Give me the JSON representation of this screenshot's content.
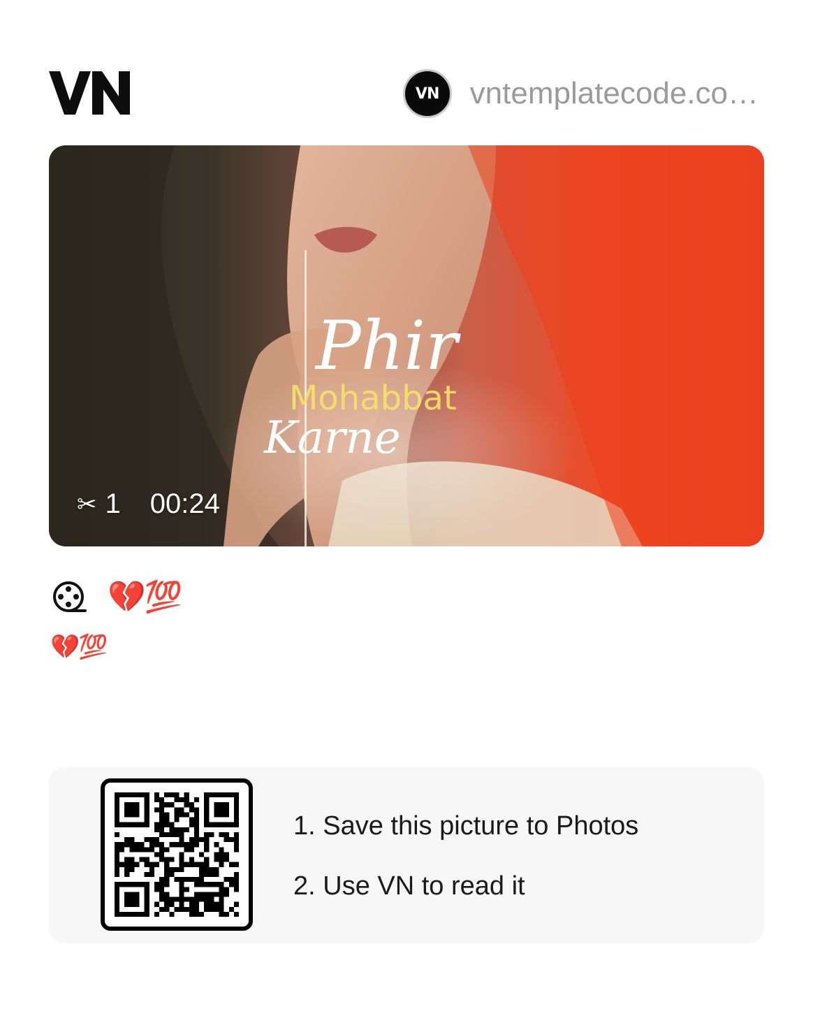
{
  "header": {
    "logo_text": "VN",
    "author_avatar_text": "VN",
    "author_name": "vntemplatecode.co…"
  },
  "preview": {
    "overlay_text": {
      "line1": "Phir",
      "line2": "Mohabbat",
      "line3": "Karne"
    },
    "clip_icon": "scissors-icon",
    "clip_count": "1",
    "duration": "00:24"
  },
  "template": {
    "icon": "film-reel-icon",
    "title": "💔💯",
    "description": "💔💯"
  },
  "qr": {
    "steps": [
      "1. Save this picture to Photos",
      "2. Use VN to read it"
    ]
  },
  "colors": {
    "accent_text": "#e8236a",
    "card_background": "#f7f7f7",
    "muted_text": "#9a9a9a"
  }
}
